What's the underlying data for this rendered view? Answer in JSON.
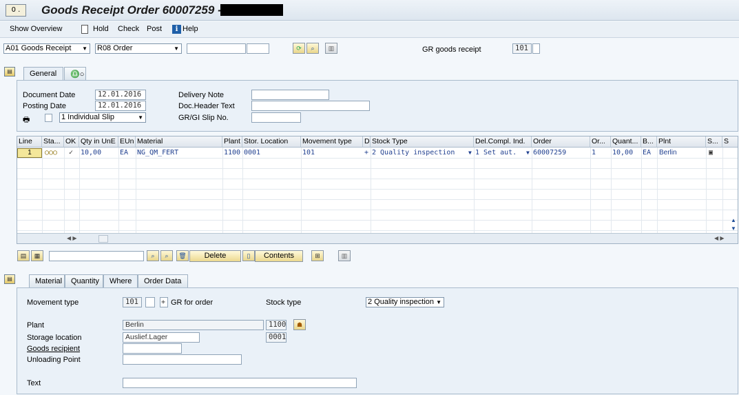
{
  "title": {
    "text": "Goods Receipt Order 60007259 -",
    "icon_label": "0 ."
  },
  "toolbar": {
    "show_overview": "Show Overview",
    "hold": "Hold",
    "check": "Check",
    "post": "Post",
    "help": "Help",
    "info_glyph": "i"
  },
  "selection": {
    "transaction": "A01 Goods Receipt",
    "reference": "R08 Order",
    "order_input": "",
    "order_item_input": "",
    "gr_label": "GR goods receipt",
    "gr_value": "101"
  },
  "header_tabs": [
    {
      "label": "General"
    },
    {
      "label": "♎○"
    }
  ],
  "general": {
    "document_date_label": "Document Date",
    "document_date": "12.01.2016",
    "posting_date_label": "Posting Date",
    "posting_date": "12.01.2016",
    "slip_option": "1 Individual Slip",
    "delivery_note_label": "Delivery Note",
    "delivery_note": "",
    "doc_header_label": "Doc.Header Text",
    "doc_header": "",
    "gr_gi_slip_label": "GR/GI Slip No.",
    "gr_gi_slip": ""
  },
  "grid": {
    "columns": [
      "Line",
      "Sta...",
      "OK",
      "Qty in UnE",
      "EUn",
      "Material",
      "Plant",
      "Stor. Location",
      "Movement type",
      "D",
      "Stock Type",
      "Del.Compl. Ind.",
      "Order",
      "Or...",
      "Quant...",
      "B...",
      "Plnt",
      "S...",
      "S"
    ],
    "row": {
      "line": "1",
      "status": "○○○",
      "ok": "✓",
      "qty": "10,00",
      "eun": "EA",
      "material": "NG_QM_FERT",
      "plant": "1100",
      "stor_loc": "0001",
      "movement_type": "101",
      "d": "+",
      "stock_type": "2 Quality inspection",
      "del_compl": "1 Set aut.",
      "order": "60007259",
      "or": "1",
      "quant": "10,00",
      "b": "EA",
      "plnt": "Berlin"
    }
  },
  "grid_buttons": {
    "delete": "Delete",
    "contents": "Contents",
    "search_input": ""
  },
  "item_tabs": [
    {
      "label": "Material"
    },
    {
      "label": "Quantity"
    },
    {
      "label": "Where"
    },
    {
      "label": "Order Data"
    }
  ],
  "where": {
    "movement_type_label": "Movement type",
    "movement_type": "101",
    "movement_extra": "",
    "plus": "+",
    "gr_for_order": "GR for order",
    "stock_type_label": "Stock type",
    "stock_type": "2 Quality inspection",
    "plant_label": "Plant",
    "plant_name": "Berlin",
    "plant_code": "1100",
    "storage_location_label": "Storage location",
    "storage_location": "Auslief.Lager",
    "storage_location_code": "0001",
    "goods_recipient_label": "Goods recipient",
    "goods_recipient": "",
    "unloading_point_label": "Unloading Point",
    "unloading_point": "",
    "text_label": "Text",
    "text": ""
  }
}
